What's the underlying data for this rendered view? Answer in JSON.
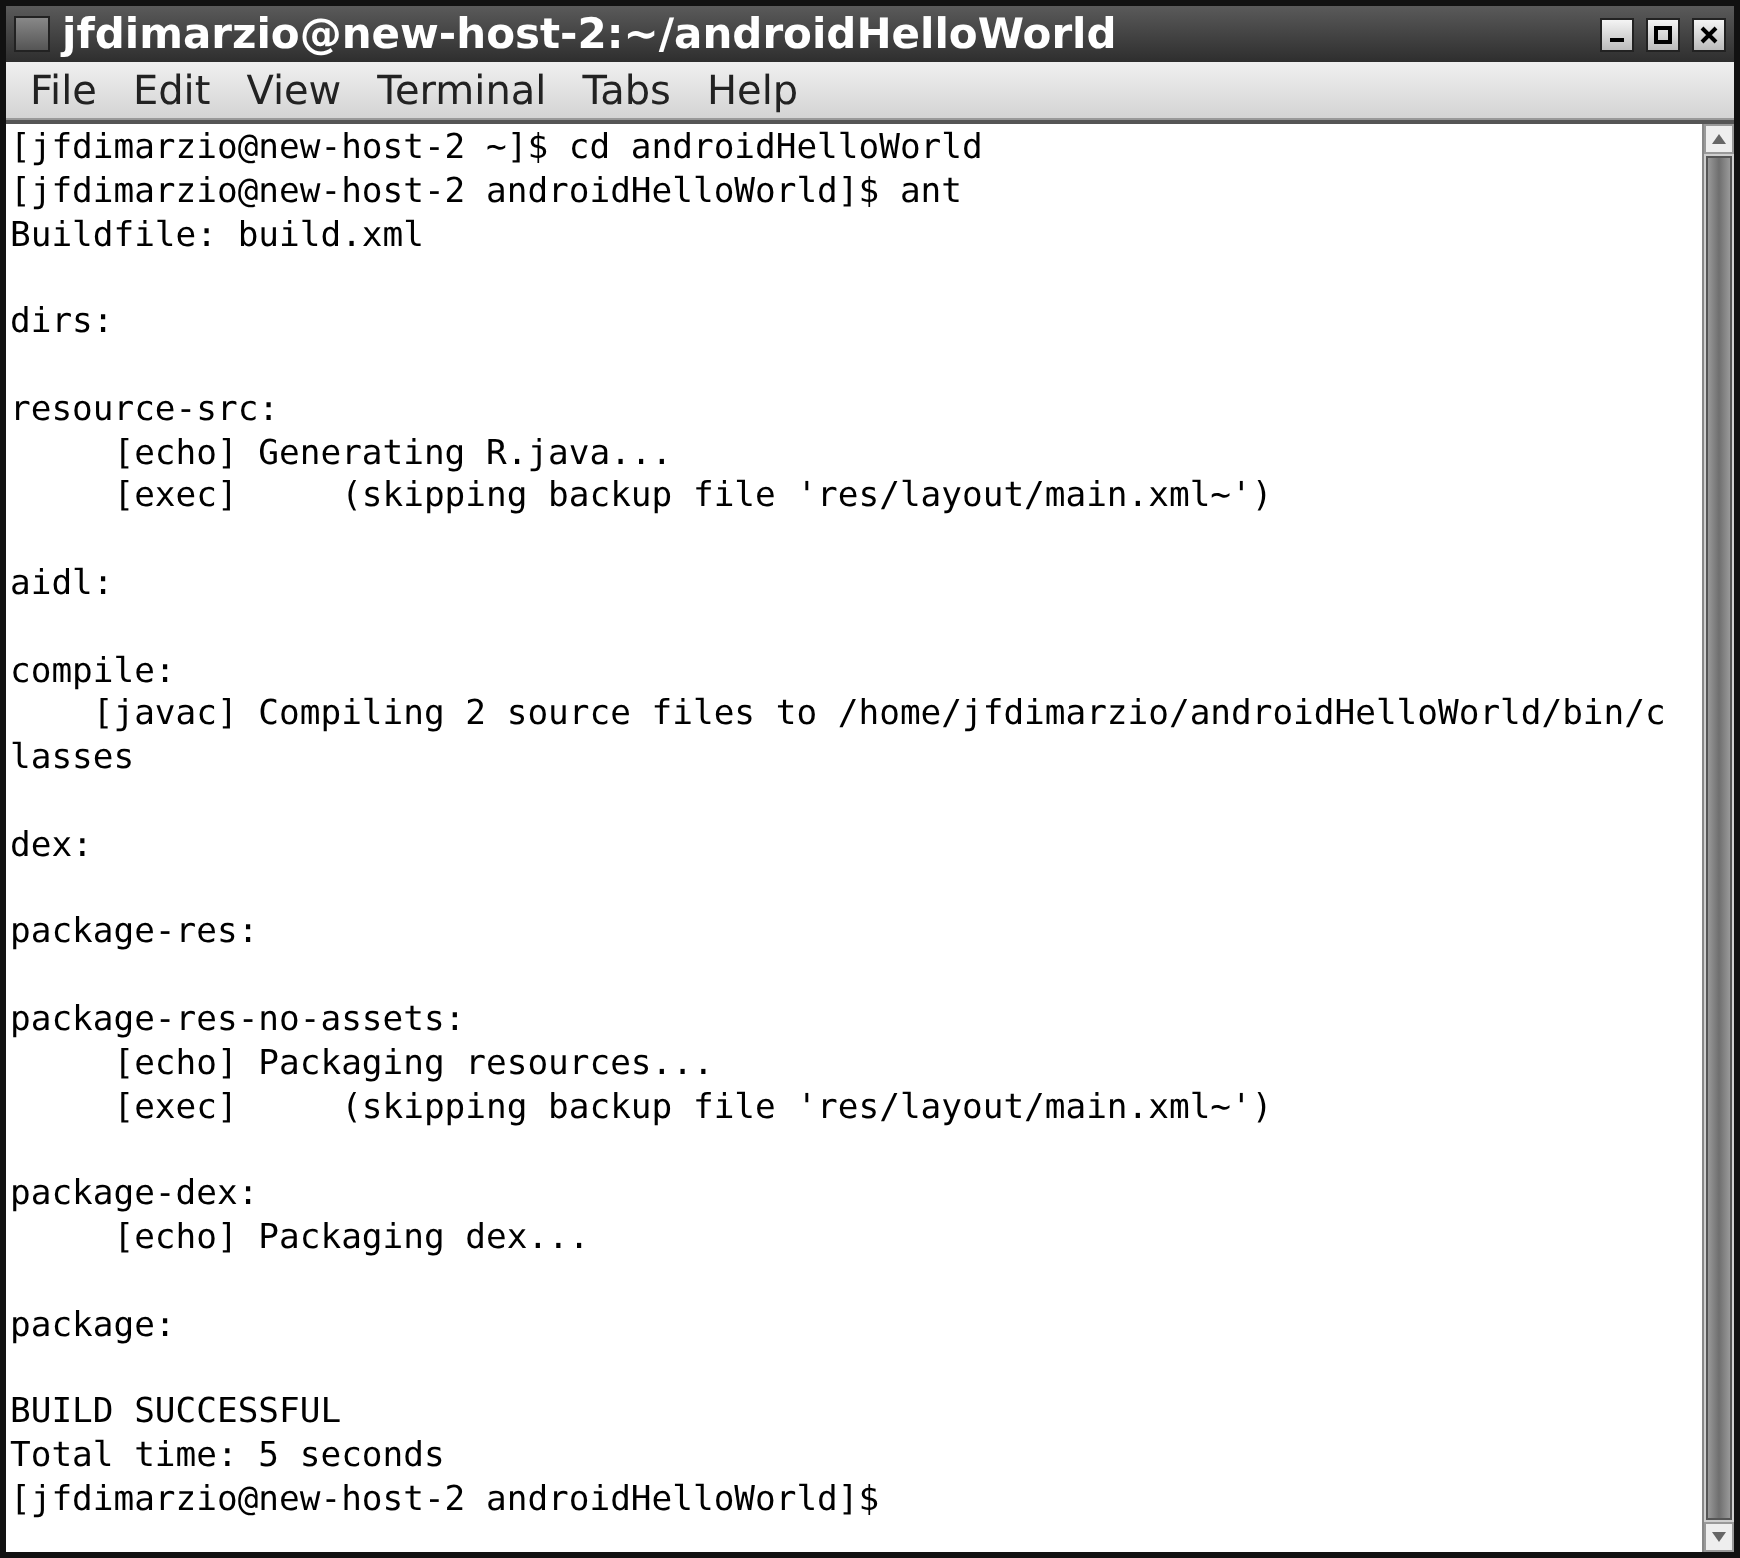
{
  "window": {
    "title": "jfdimarzio@new-host-2:~/androidHelloWorld"
  },
  "menu": [
    {
      "label": "File"
    },
    {
      "label": "Edit"
    },
    {
      "label": "View"
    },
    {
      "label": "Terminal"
    },
    {
      "label": "Tabs"
    },
    {
      "label": "Help"
    }
  ],
  "terminal": {
    "blocks": [
      [
        "[jfdimarzio@new-host-2 ~]$ cd androidHelloWorld",
        "[jfdimarzio@new-host-2 androidHelloWorld]$ ant",
        "Buildfile: build.xml"
      ],
      [
        "dirs:"
      ],
      [
        "resource-src:",
        "     [echo] Generating R.java...",
        "     [exec]     (skipping backup file 'res/layout/main.xml~')"
      ],
      [
        "aidl:"
      ],
      [
        "compile:",
        "    [javac] Compiling 2 source files to /home/jfdimarzio/androidHelloWorld/bin/c",
        "lasses"
      ],
      [
        "dex:"
      ],
      [
        "package-res:"
      ],
      [
        "package-res-no-assets:",
        "     [echo] Packaging resources...",
        "     [exec]     (skipping backup file 'res/layout/main.xml~')"
      ],
      [
        "package-dex:",
        "     [echo] Packaging dex..."
      ],
      [
        "package:"
      ],
      [
        "BUILD SUCCESSFUL",
        "Total time: 5 seconds",
        "[jfdimarzio@new-host-2 androidHelloWorld]$"
      ]
    ]
  }
}
